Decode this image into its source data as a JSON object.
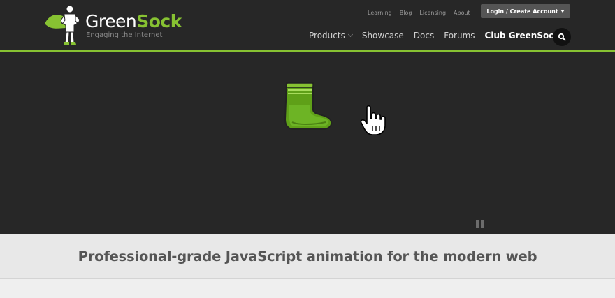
{
  "header": {
    "logo": {
      "name_light": "Green",
      "name_bold": "Sock",
      "tagline": "Engaging the Internet",
      "icon": "superhero-mascot-icon"
    },
    "top_links": [
      "Learning",
      "Blog",
      "Licensing",
      "About"
    ],
    "login_label": "Login / Create Account",
    "nav": {
      "products": "Products",
      "showcase": "Showcase",
      "docs": "Docs",
      "forums": "Forums",
      "club": "Club GreenSock"
    },
    "search_icon": "search-icon"
  },
  "hero": {
    "graphic": "green-sock-icon",
    "cursor": "hand-pointer-icon",
    "pause_icon": "pause-icon"
  },
  "tagline": "Professional-grade JavaScript animation for the modern web",
  "colors": {
    "brand_green": "#87c232",
    "header_bg": "#272727",
    "band_bg": "#e8e8e8"
  }
}
